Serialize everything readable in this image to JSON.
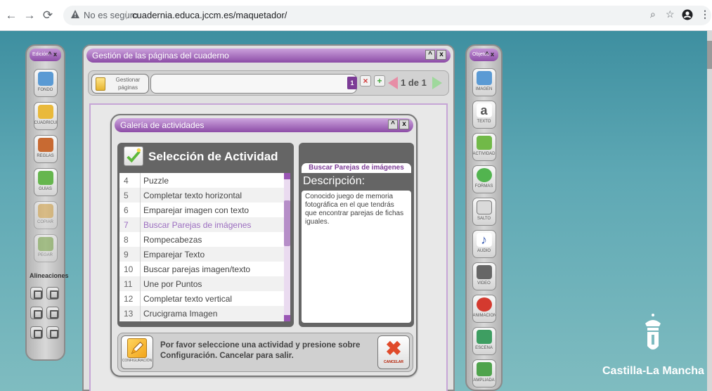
{
  "browser": {
    "not_secure": "No es seguro",
    "url": "cuadernia.educa.jccm.es/maquetador/"
  },
  "left_panel": {
    "title": "Edición",
    "tools": [
      {
        "label": "FONDO",
        "icon": "background-icon",
        "color": "#5a9ad4"
      },
      {
        "label": "CUADRÍCULA",
        "icon": "grid-icon",
        "color": "#e9b93b"
      },
      {
        "label": "REGLAS",
        "icon": "ruler-icon",
        "color": "#c86a32"
      },
      {
        "label": "GUÍAS",
        "icon": "guides-icon",
        "color": "#66b64e"
      },
      {
        "label": "COPIAR",
        "icon": "copy-icon",
        "color": "#d9a544"
      },
      {
        "label": "PEGAR",
        "icon": "paste-icon",
        "color": "#79a846"
      }
    ],
    "alignments_label": "Alineaciones"
  },
  "main_window": {
    "title": "Gestión de las páginas del cuaderno",
    "manage_pages_label": "Gestionar páginas",
    "current_page_badge": "1",
    "page_count": "1 de 1"
  },
  "gallery": {
    "title": "Galería de actividades",
    "selection_title": "Selección de Actividad",
    "activities": [
      {
        "num": "4",
        "name": "Puzzle"
      },
      {
        "num": "5",
        "name": "Completar texto horizontal"
      },
      {
        "num": "6",
        "name": "Emparejar imagen con texto"
      },
      {
        "num": "7",
        "name": "Buscar Parejas de imágenes"
      },
      {
        "num": "8",
        "name": "Rompecabezas"
      },
      {
        "num": "9",
        "name": "Emparejar Texto"
      },
      {
        "num": "10",
        "name": "Buscar parejas imagen/texto"
      },
      {
        "num": "11",
        "name": "Une por Puntos"
      },
      {
        "num": "12",
        "name": "Completar texto vertical"
      },
      {
        "num": "13",
        "name": "Crucigrama Imagen"
      }
    ],
    "selected_index": 3,
    "selected_activity": "Buscar Parejas de imágenes",
    "description_label": "Descripción:",
    "description_text": "Conocido juego de memoria fotográfica en el que tendrás que encontrar parejas de fichas iguales.",
    "config_label": "CONFIGURACIÓN",
    "instruction_text": "Por favor seleccione una actividad y presione sobre Configuración. Cancelar para salir.",
    "cancel_label": "CANCELAR"
  },
  "right_panel": {
    "title": "Objetos",
    "tools": [
      {
        "label": "IMAGEN",
        "icon": "image-icon",
        "color": "#5a9ad4"
      },
      {
        "label": "TEXTO",
        "icon": "text-icon",
        "color": "#555555"
      },
      {
        "label": "ACTIVIDAD",
        "icon": "activity-icon",
        "color": "#71b948"
      },
      {
        "label": "FORMAS",
        "icon": "shapes-icon",
        "color": "#52b44f"
      },
      {
        "label": "SALTO",
        "icon": "jump-icon",
        "color": "#7a7a7a"
      },
      {
        "label": "AUDIO",
        "icon": "audio-icon",
        "color": "#3e5fb3"
      },
      {
        "label": "VÍDEO",
        "icon": "video-icon",
        "color": "#666666"
      },
      {
        "label": "ANIMACIÓN",
        "icon": "animation-icon",
        "color": "#d43a2f"
      },
      {
        "label": "ESCENA",
        "icon": "scene-icon",
        "color": "#3e9e62"
      },
      {
        "label": "AMPLIADA",
        "icon": "zoom-icon",
        "color": "#4fa34c"
      }
    ]
  },
  "brand": {
    "name": "Castilla-La Mancha"
  }
}
